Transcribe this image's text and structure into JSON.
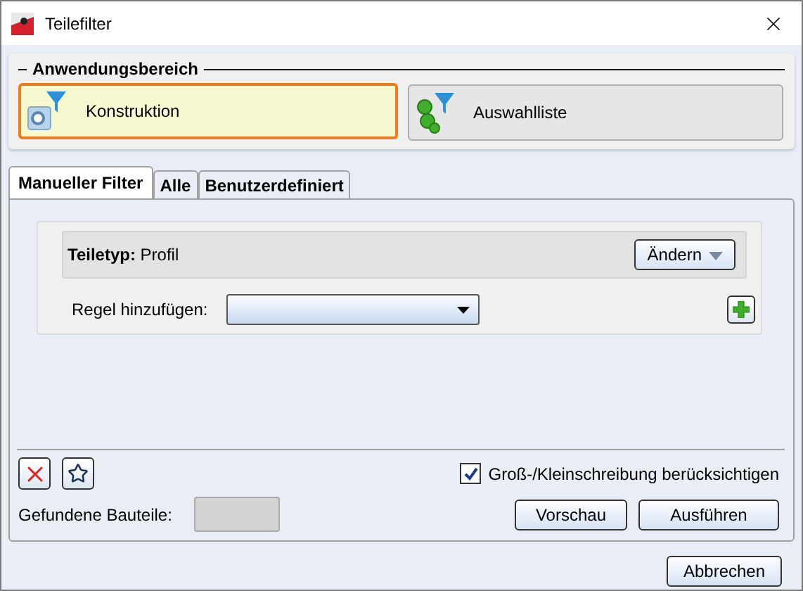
{
  "window": {
    "title": "Teilefilter"
  },
  "scope": {
    "title": "Anwendungsbereich",
    "options": [
      {
        "label": "Konstruktion",
        "selected": true,
        "kind": "construction"
      },
      {
        "label": "Auswahlliste",
        "selected": false,
        "kind": "selection"
      }
    ]
  },
  "tabs": [
    {
      "label": "Manueller Filter",
      "selected": true
    },
    {
      "label": "Alle",
      "selected": false
    },
    {
      "label": "Benutzerdefiniert",
      "selected": false
    }
  ],
  "part_type": {
    "label": "Teiletyp:",
    "value": "Profil",
    "button": "Ändern"
  },
  "rule": {
    "label": "Regel hinzufügen:"
  },
  "case_sensitive": {
    "label": "Groß-/Kleinschreibung berücksichtigen",
    "checked": true
  },
  "found": {
    "label": "Gefundene Bauteile:"
  },
  "actions": [
    "Vorschau",
    "Ausführen"
  ],
  "cancel": "Abbrechen"
}
